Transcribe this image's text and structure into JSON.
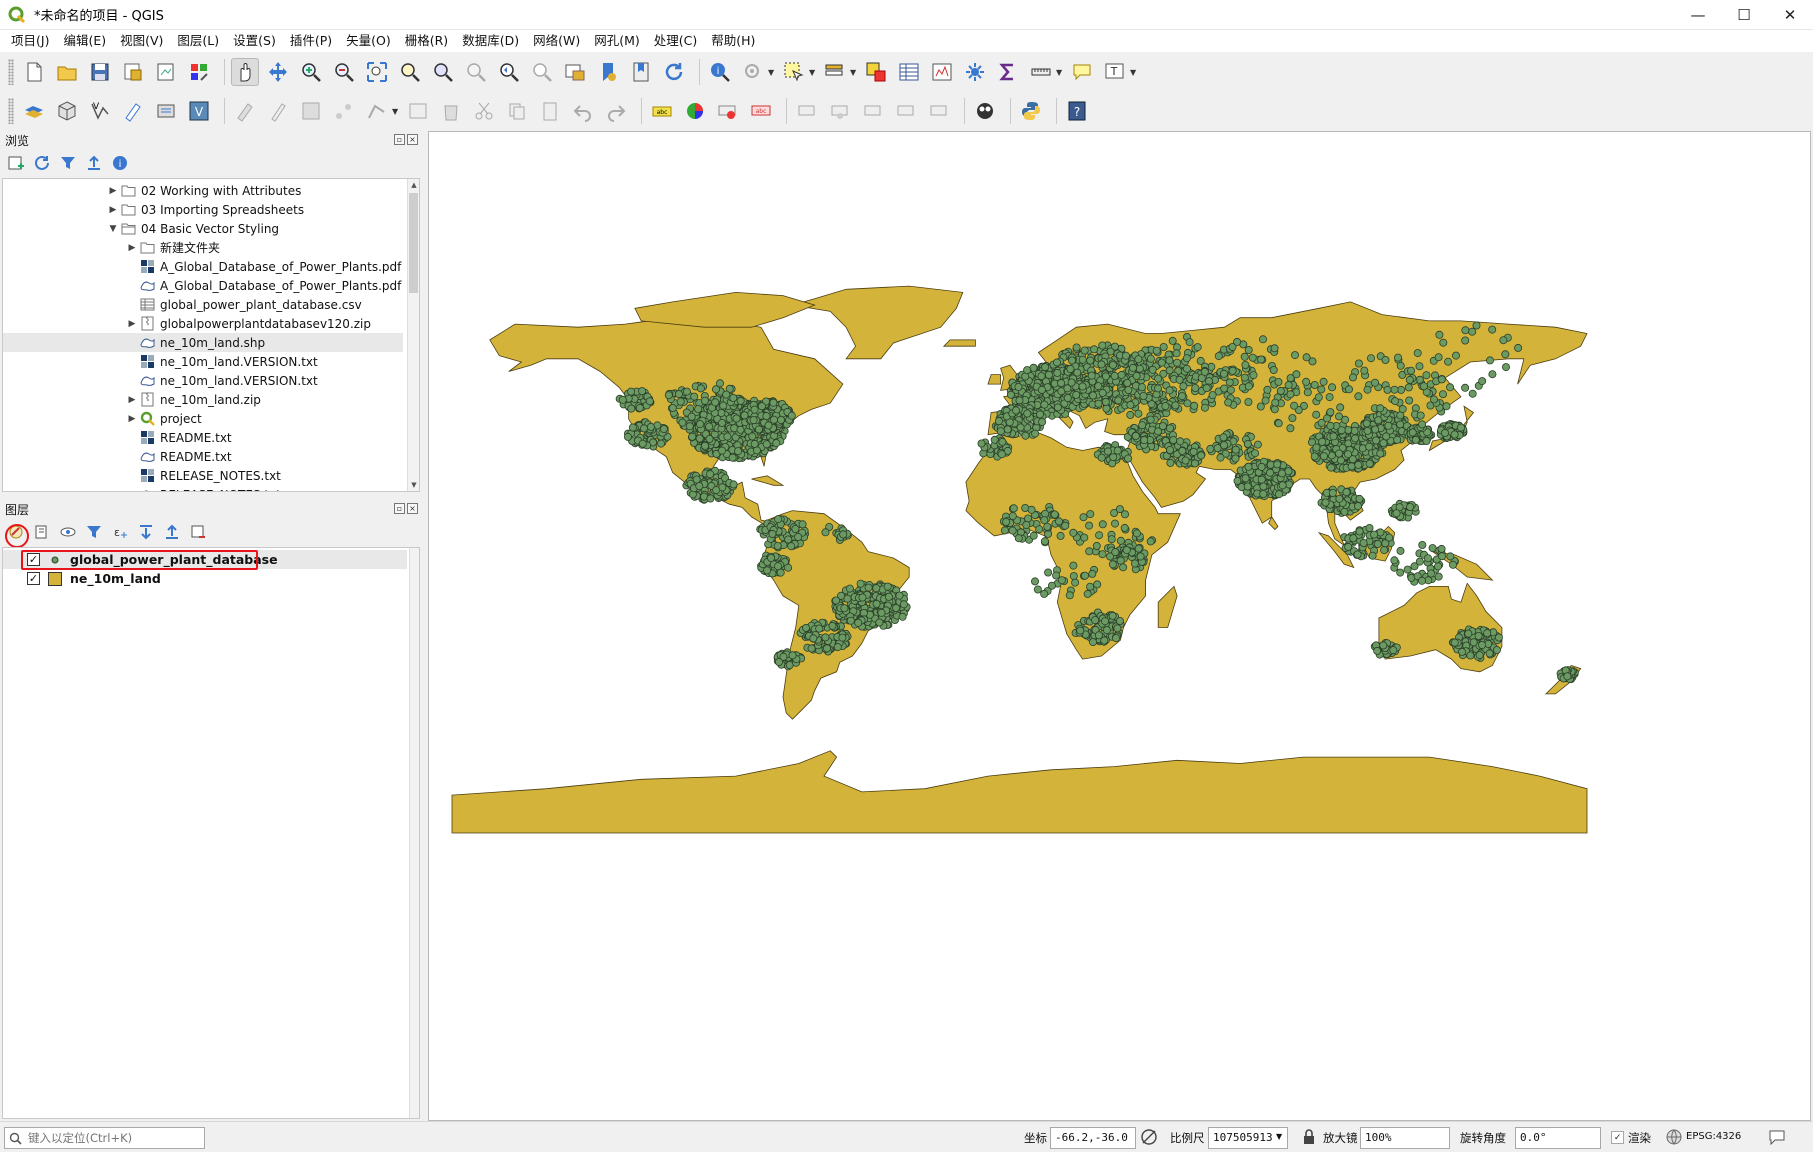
{
  "window": {
    "title": "*未命名的项目 - QGIS",
    "controls": {
      "minimize": "—",
      "maximize": "☐",
      "close": "✕"
    }
  },
  "menu": [
    "项目(J)",
    "编辑(E)",
    "视图(V)",
    "图层(L)",
    "设置(S)",
    "插件(P)",
    "矢量(O)",
    "栅格(R)",
    "数据库(D)",
    "网络(W)",
    "网孔(M)",
    "处理(C)",
    "帮助(H)"
  ],
  "browser": {
    "title": "浏览",
    "items": [
      {
        "label": "02 Working with Attributes",
        "type": "folder",
        "expandable": true,
        "level": 1
      },
      {
        "label": "03 Importing Spreadsheets",
        "type": "folder",
        "expandable": true,
        "level": 1
      },
      {
        "label": "04 Basic Vector Styling",
        "type": "folder-open",
        "expandable": true,
        "expanded": true,
        "level": 1
      },
      {
        "label": "新建文件夹",
        "type": "folder",
        "expandable": true,
        "level": 2
      },
      {
        "label": "A_Global_Database_of_Power_Plants.pdf",
        "type": "raster",
        "level": 2
      },
      {
        "label": "A_Global_Database_of_Power_Plants.pdf",
        "type": "vector",
        "level": 2
      },
      {
        "label": "global_power_plant_database.csv",
        "type": "table",
        "level": 2
      },
      {
        "label": "globalpowerplantdatabasev120.zip",
        "type": "zip",
        "expandable": true,
        "level": 2
      },
      {
        "label": "ne_10m_land.shp",
        "type": "vector",
        "level": 2,
        "selected": true
      },
      {
        "label": "ne_10m_land.VERSION.txt",
        "type": "raster",
        "level": 2
      },
      {
        "label": "ne_10m_land.VERSION.txt",
        "type": "vector",
        "level": 2
      },
      {
        "label": "ne_10m_land.zip",
        "type": "zip",
        "expandable": true,
        "level": 2
      },
      {
        "label": "project",
        "type": "qgis",
        "expandable": true,
        "level": 2
      },
      {
        "label": "README.txt",
        "type": "raster",
        "level": 2
      },
      {
        "label": "README.txt",
        "type": "vector",
        "level": 2
      },
      {
        "label": "RELEASE_NOTES.txt",
        "type": "raster",
        "level": 2
      },
      {
        "label": "RELEASE_NOTES.txt",
        "type": "vector",
        "level": 2
      }
    ]
  },
  "layers": {
    "title": "图层",
    "items": [
      {
        "name": "global_power_plant_database",
        "checked": true,
        "symbol": "point",
        "highlighted": true
      },
      {
        "name": "ne_10m_land",
        "checked": true,
        "symbol": "polygon"
      }
    ]
  },
  "map": {
    "land_color": "#d4b33b",
    "point_fill": "#6b9a63",
    "point_stroke": "#2b3f28",
    "background": "#ffffff"
  },
  "status": {
    "locator_placeholder": "键入以定位(Ctrl+K)",
    "coord_label": "坐标",
    "coord_value": "-66.2,-36.0",
    "scale_label": "比例尺",
    "scale_value": "107505913",
    "magnifier_label": "放大镜",
    "magnifier_value": "100%",
    "rotation_label": "旋转角度",
    "rotation_value": "0.0°",
    "render_label": "渲染",
    "crs": "EPSG:4326"
  },
  "colors": {
    "highlight": "#e8141a",
    "selected_row": "#e8e8e8"
  }
}
